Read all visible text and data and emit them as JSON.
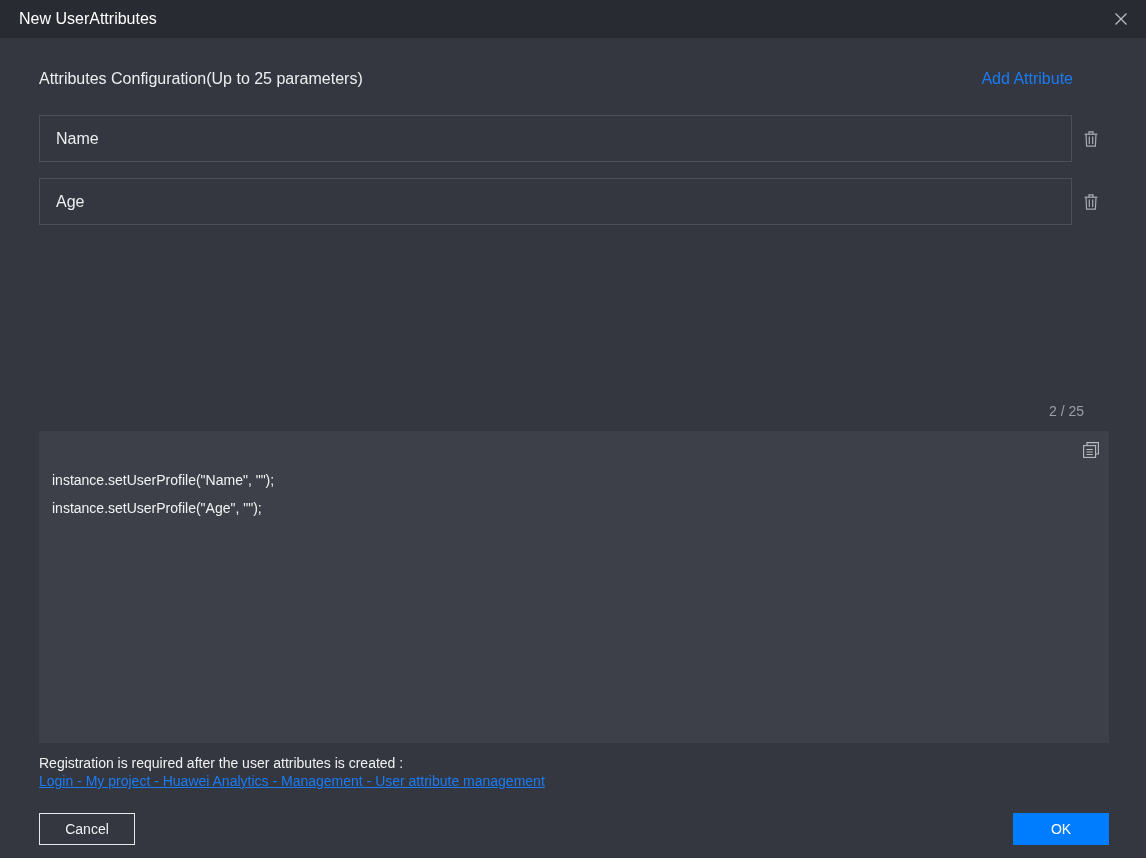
{
  "window": {
    "title": "New UserAttributes"
  },
  "attributes": {
    "heading": "Attributes Configuration(Up to 25 parameters)",
    "add_link": "Add Attribute",
    "items": [
      {
        "value": "Name"
      },
      {
        "value": "Age"
      }
    ],
    "counter": "2 / 25"
  },
  "code": {
    "lines": [
      "instance.setUserProfile(\"Name\", \"\");",
      "instance.setUserProfile(\"Age\", \"\");"
    ]
  },
  "note": {
    "text": "Registration is required after the user attributes is created :",
    "link": "Login - My project - Huawei Analytics - Management - User attribute management"
  },
  "buttons": [
    {
      "label": "Cancel",
      "kind": "secondary"
    },
    {
      "label": "OK",
      "kind": "primary"
    }
  ]
}
